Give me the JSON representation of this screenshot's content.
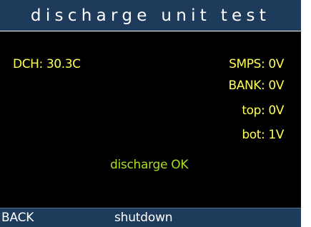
{
  "title": "discharge unit test",
  "readings": {
    "dch": "DCH: 30.3C",
    "smps": "SMPS: 0V",
    "bank": "BANK: 0V",
    "top": "top: 0V",
    "bot": "bot: 1V"
  },
  "status": "discharge OK",
  "soft_keys": {
    "back": "BACK",
    "shutdown": "shutdown"
  },
  "colors": {
    "background": "#000000",
    "bar": "#1f3b5c",
    "reading_text": "#ffff55",
    "status_text": "#aadd22",
    "bar_text": "#ffffff"
  }
}
